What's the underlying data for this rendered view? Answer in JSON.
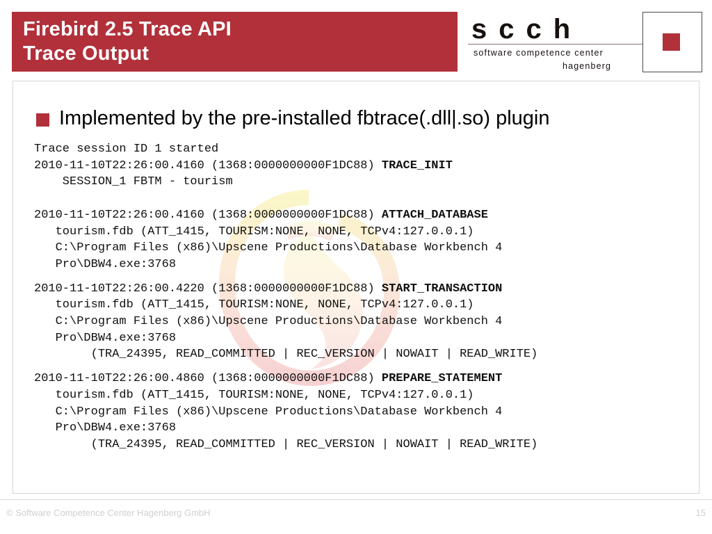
{
  "slide": {
    "title_line1": "Firebird 2.5 Trace API",
    "title_line2": "Trace Output",
    "accent_color": "#b1303a"
  },
  "logo": {
    "wordmark": "scch",
    "subtitle_line1": "software competence center",
    "subtitle_line2": "hagenberg"
  },
  "bullet": {
    "text": "Implemented by the pre-installed fbtrace(.dll|.so) plugin"
  },
  "trace_output": {
    "blocks": [
      {
        "lines": [
          {
            "text": "Trace session ID 1 started",
            "bold_tail": ""
          },
          {
            "text": "2010-11-10T22:26:00.4160 (1368:0000000000F1DC88) ",
            "bold_tail": "TRACE_INIT"
          },
          {
            "text": "    SESSION_1 FBTM - tourism",
            "bold_tail": ""
          }
        ]
      },
      {
        "lines": [
          {
            "text": "2010-11-10T22:26:00.4160 (1368:0000000000F1DC88) ",
            "bold_tail": "ATTACH_DATABASE"
          },
          {
            "text": "   tourism.fdb (ATT_1415, TOURISM:NONE, NONE, TCPv4:127.0.0.1)",
            "bold_tail": ""
          },
          {
            "text": "   C:\\Program Files (x86)\\Upscene Productions\\Database Workbench 4",
            "bold_tail": ""
          },
          {
            "text": "   Pro\\DBW4.exe:3768",
            "bold_tail": ""
          }
        ]
      },
      {
        "lines": [
          {
            "text": "2010-11-10T22:26:00.4220 (1368:0000000000F1DC88) ",
            "bold_tail": "START_TRANSACTION"
          },
          {
            "text": "   tourism.fdb (ATT_1415, TOURISM:NONE, NONE, TCPv4:127.0.0.1)",
            "bold_tail": ""
          },
          {
            "text": "   C:\\Program Files (x86)\\Upscene Productions\\Database Workbench 4",
            "bold_tail": ""
          },
          {
            "text": "   Pro\\DBW4.exe:3768",
            "bold_tail": ""
          },
          {
            "text": "        (TRA_24395, READ_COMMITTED | REC_VERSION | NOWAIT | READ_WRITE)",
            "bold_tail": ""
          }
        ]
      },
      {
        "lines": [
          {
            "text": "2010-11-10T22:26:00.4860 (1368:0000000000F1DC88) ",
            "bold_tail": "PREPARE_STATEMENT"
          },
          {
            "text": "   tourism.fdb (ATT_1415, TOURISM:NONE, NONE, TCPv4:127.0.0.1)",
            "bold_tail": ""
          },
          {
            "text": "   C:\\Program Files (x86)\\Upscene Productions\\Database Workbench 4",
            "bold_tail": ""
          },
          {
            "text": "   Pro\\DBW4.exe:3768",
            "bold_tail": ""
          },
          {
            "text": "        (TRA_24395, READ_COMMITTED | REC_VERSION | NOWAIT | READ_WRITE)",
            "bold_tail": ""
          }
        ]
      }
    ]
  },
  "footer": {
    "copyright": "© Software Competence Center Hagenberg GmbH",
    "page_number": "15"
  },
  "watermark": {
    "name": "firebird-logo-watermark"
  }
}
